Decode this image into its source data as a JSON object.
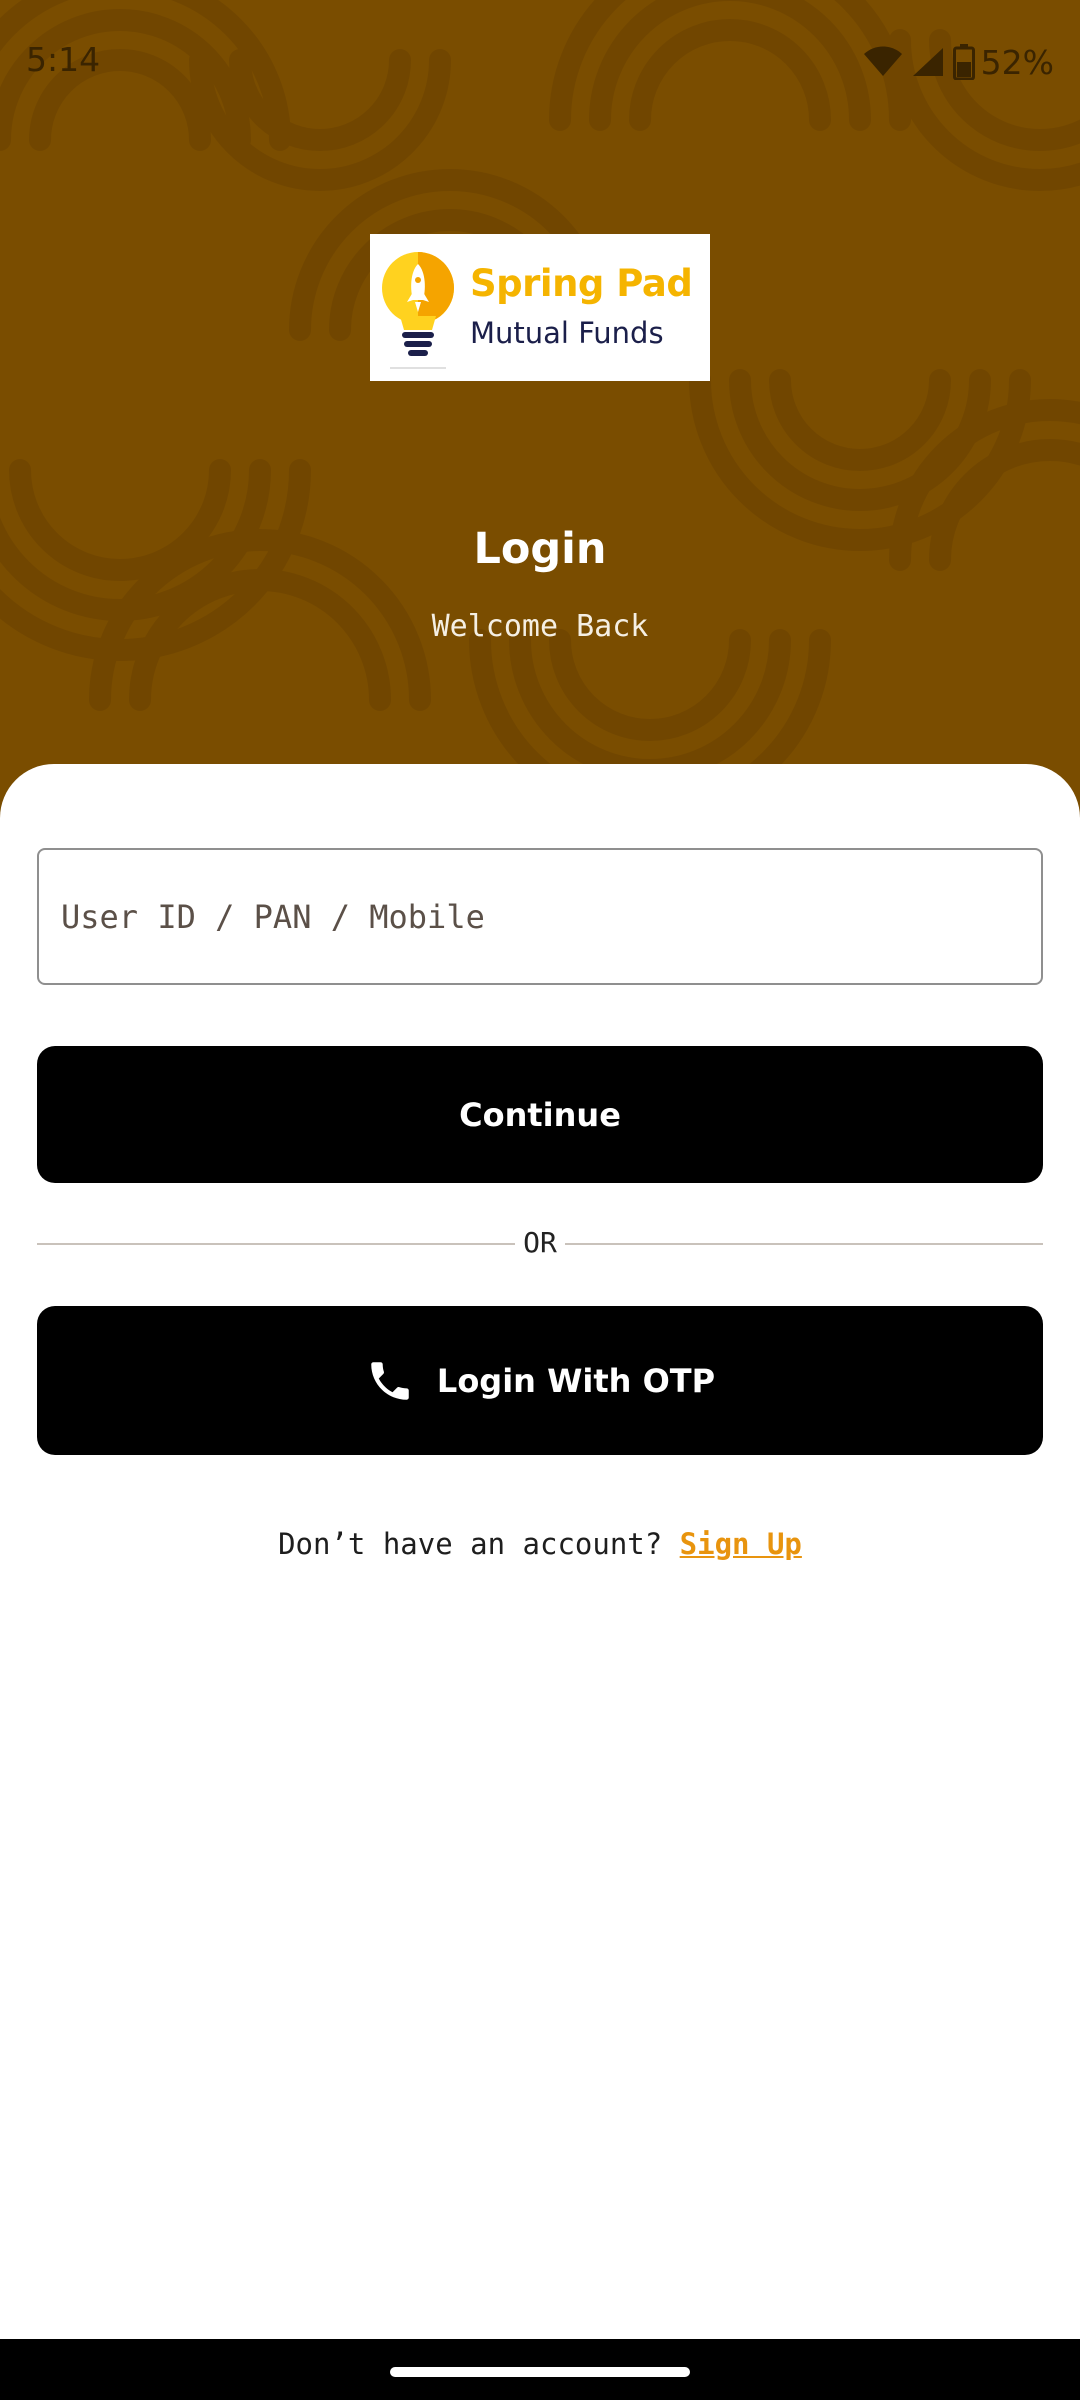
{
  "status_bar": {
    "time": "5:14",
    "battery_percent": "52%",
    "icons": [
      "wifi-icon",
      "cellular-signal-icon",
      "battery-icon"
    ]
  },
  "logo": {
    "line1": "Spring Pad",
    "line2": "Mutual Funds",
    "icon": "lightbulb-rocket-icon"
  },
  "header": {
    "title": "Login",
    "subtitle": "Welcome Back"
  },
  "form": {
    "user_id_placeholder": "User ID / PAN / Mobile",
    "user_id_value": "",
    "continue_label": "Continue",
    "divider_text": "OR",
    "otp_label": "Login With OTP",
    "otp_icon": "phone-icon"
  },
  "signup": {
    "prompt": "Don’t have an account? ",
    "link_label": "Sign Up"
  },
  "colors": {
    "hero_background": "#7a4d00",
    "accent": "#e8940e",
    "button": "#000000",
    "logo_yellow": "#f5b400",
    "logo_navy": "#1b1f4a"
  }
}
